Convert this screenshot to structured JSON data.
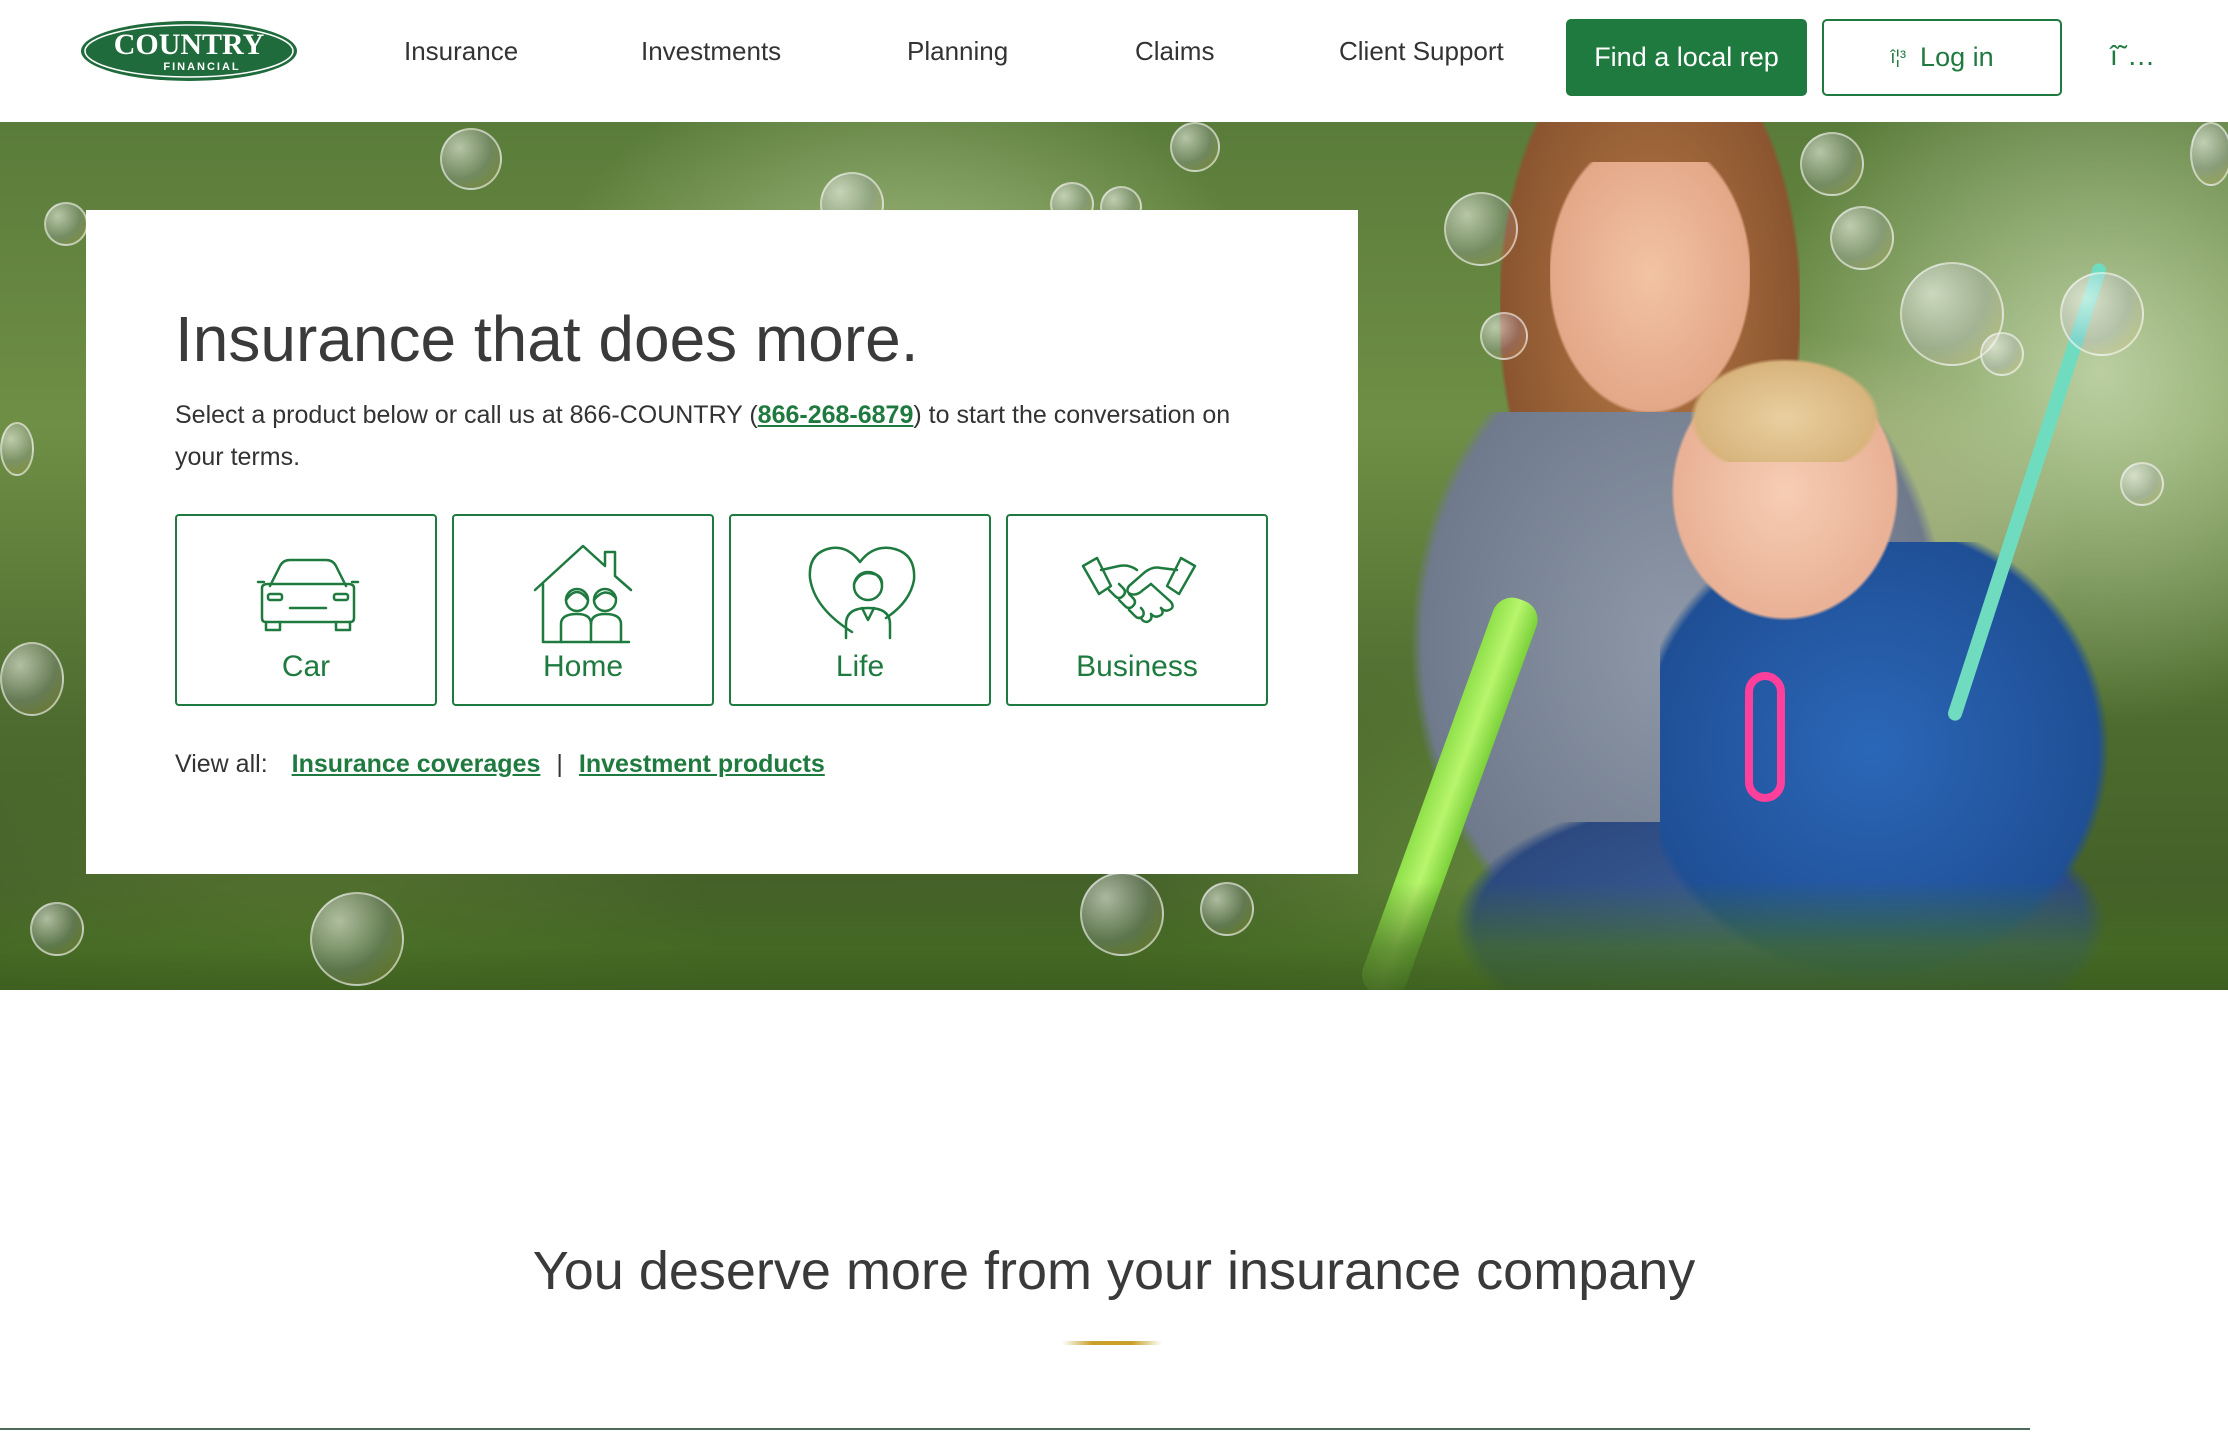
{
  "brand": {
    "logo_top": "COUNTRY",
    "logo_bottom": "FINANCIAL",
    "primary_color": "#1f7a3f"
  },
  "nav": {
    "items": [
      "Insurance",
      "Investments",
      "Planning",
      "Claims",
      "Client Support"
    ],
    "find_rep_label": "Find a local rep",
    "login_label": "Log in",
    "login_icon": "lock-icon",
    "login_icon_glyph": "î¦³",
    "menu_icon": "more-menu-icon",
    "menu_glyph": "î˜…"
  },
  "hero": {
    "title": "Insurance that does more.",
    "subtitle_before": "Select a product below or call us at 866-COUNTRY (",
    "phone_link": "866-268-6879",
    "subtitle_after": ") to start the conversation on your terms.",
    "products": [
      {
        "label": "Car",
        "icon": "car-icon"
      },
      {
        "label": "Home",
        "icon": "home-family-icon"
      },
      {
        "label": "Life",
        "icon": "heart-person-icon"
      },
      {
        "label": "Business",
        "icon": "handshake-icon"
      }
    ],
    "view_all_label": "View all:",
    "view_all_links": [
      "Insurance coverages",
      "Investment products"
    ],
    "separator": "|"
  },
  "section": {
    "title": "You deserve more from your insurance company",
    "accent_color": "#c9a12a"
  }
}
